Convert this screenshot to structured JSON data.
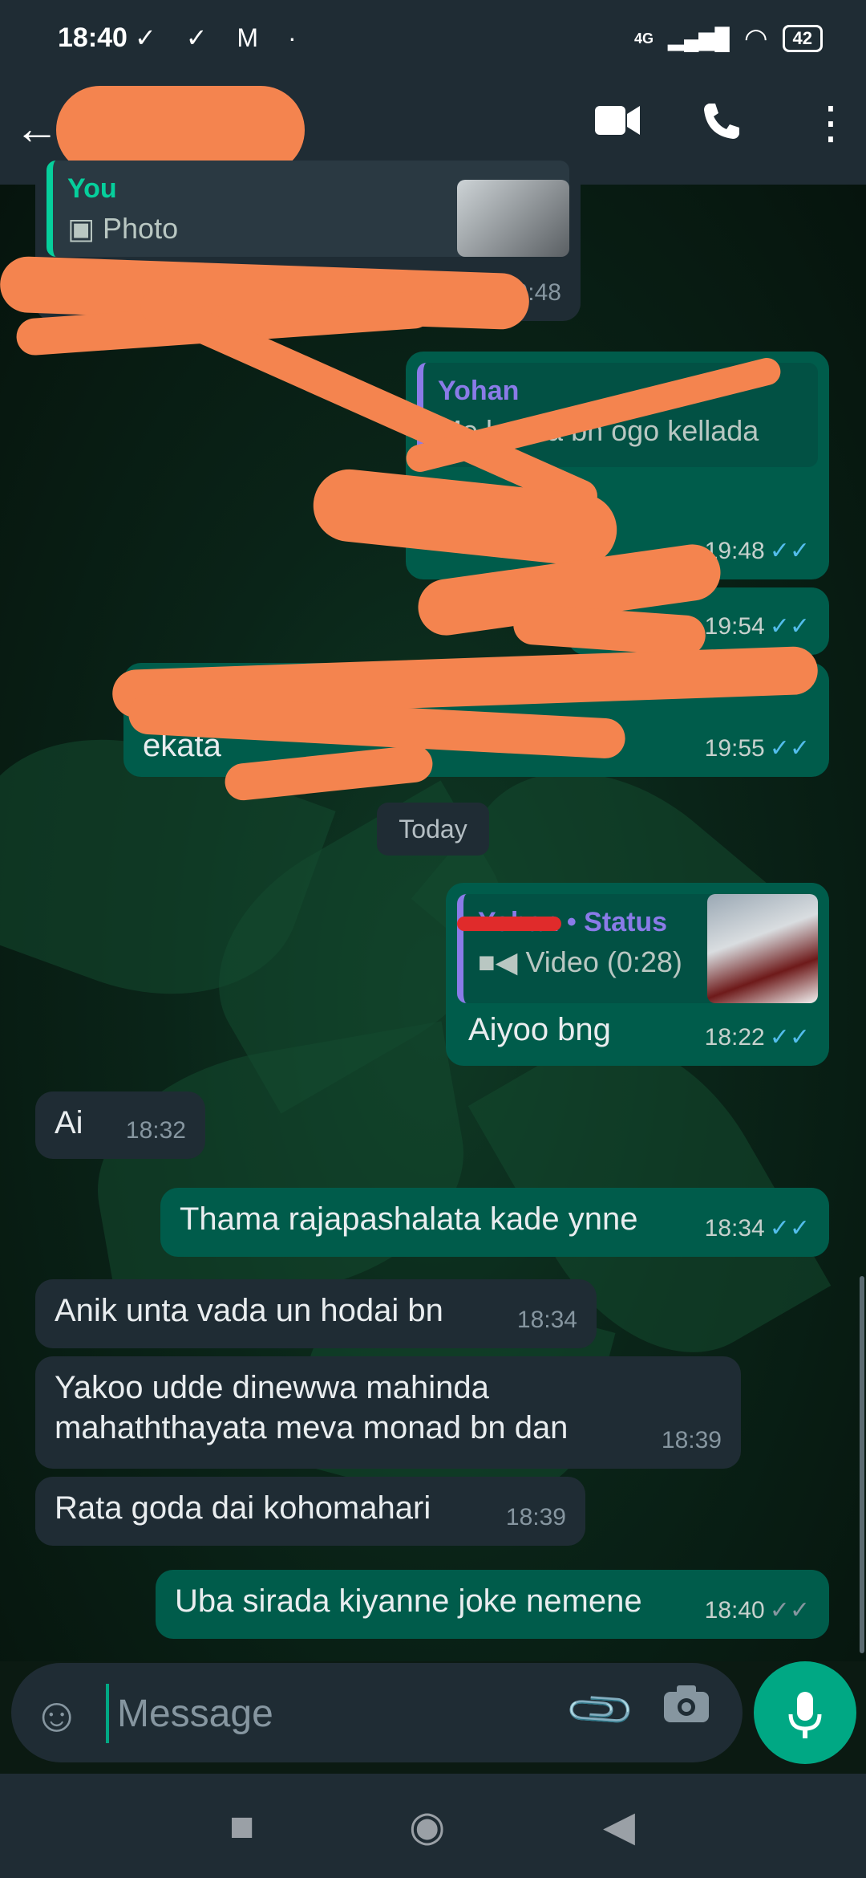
{
  "status_bar": {
    "time": "18:40",
    "left_icons": "✓ ✓ M ·",
    "network": "4G",
    "battery": "42"
  },
  "app_bar": {
    "back_icon": "arrow-left-icon",
    "video_icon": "videocam-icon",
    "call_icon": "phone-icon",
    "menu_icon": "more-vert-icon"
  },
  "messages": {
    "m1": {
      "quote_name": "You",
      "quote_text": "Photo",
      "time": "19:48"
    },
    "m2": {
      "quote_name": "Yohan",
      "quote_text": "Me kavda bn ogo kellada",
      "time": "19:48"
    },
    "m3": {
      "time": "19:54"
    },
    "m4": {
      "text_line1": "Ara un",
      "text_line2": "ekata",
      "time": "19:55"
    },
    "date_chip": "Today",
    "m5": {
      "quote_name": "Yohan • Status",
      "quote_text": "Video (0:28)",
      "text": "Aiyoo bng",
      "time": "18:22"
    },
    "m6": {
      "text": "Ai",
      "time": "18:32"
    },
    "m7": {
      "text": "Thama rajapashalata kade ynne",
      "time": "18:34"
    },
    "m8": {
      "text": "Anik unta vada un hodai bn",
      "time": "18:34"
    },
    "m9": {
      "text_line1": "Yakoo udde dinewwa mahinda",
      "text_line2": "mahaththayata meva monad bn dan",
      "time": "18:39"
    },
    "m10": {
      "text": "Rata goda dai kohomahari",
      "time": "18:39"
    },
    "m11": {
      "text": "Uba sirada kiyanne joke nemene",
      "time": "18:40"
    }
  },
  "input": {
    "placeholder": "Message"
  },
  "colors": {
    "outgoing": "#005c4b",
    "incoming": "#1f2c34",
    "accent": "#00a884",
    "read_tick": "#53bdeb",
    "scribble": "#f4844f"
  }
}
